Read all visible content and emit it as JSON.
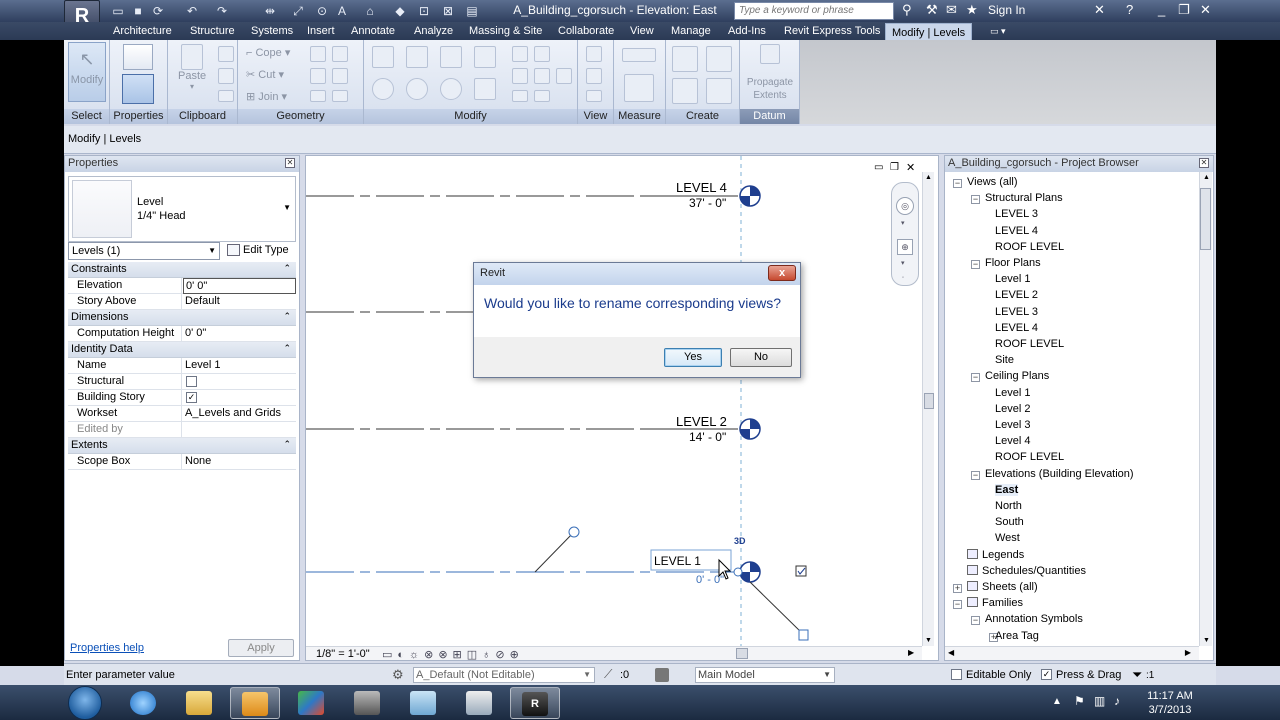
{
  "window": {
    "title": "A_Building_cgorsuch - Elevation: East",
    "search_placeholder": "Type a keyword or phrase",
    "signin": "Sign In"
  },
  "tabs": [
    "Architecture",
    "Structure",
    "Systems",
    "Insert",
    "Annotate",
    "Analyze",
    "Massing & Site",
    "Collaborate",
    "View",
    "Manage",
    "Add-Ins",
    "Revit Express Tools",
    "Modify | Levels"
  ],
  "active_tab": "Modify | Levels",
  "ribbon": {
    "modify_label": "Modify",
    "paste_label": "Paste",
    "copy_label": "Cope",
    "cut_label": "Cut",
    "join_label": "Join",
    "propagate_label": "Propagate Extents",
    "panels": {
      "select": "Select",
      "properties": "Properties",
      "clipboard": "Clipboard",
      "geometry": "Geometry",
      "modify": "Modify",
      "view": "View",
      "measure": "Measure",
      "create": "Create",
      "datum": "Datum"
    }
  },
  "options_bar": {
    "label": "Modify | Levels"
  },
  "properties": {
    "header": "Properties",
    "type_name": "Level",
    "type_sub": "1/4\" Head",
    "instance_selector": "Levels (1)",
    "edit_type": "Edit Type",
    "groups": {
      "constraints": "Constraints",
      "dimensions": "Dimensions",
      "identity": "Identity Data",
      "extents": "Extents"
    },
    "rows": {
      "elevation": {
        "k": "Elevation",
        "v": "0'  0\""
      },
      "story_above": {
        "k": "Story Above",
        "v": "Default"
      },
      "comp_height": {
        "k": "Computation Height",
        "v": "0'  0\""
      },
      "name": {
        "k": "Name",
        "v": "Level 1"
      },
      "structural": {
        "k": "Structural",
        "checked": false
      },
      "building_story": {
        "k": "Building Story",
        "checked": true
      },
      "workset": {
        "k": "Workset",
        "v": "A_Levels and Grids"
      },
      "edited_by": {
        "k": "Edited by",
        "v": ""
      },
      "scope_box": {
        "k": "Scope Box",
        "v": "None"
      }
    },
    "help_link": "Properties help",
    "apply": "Apply"
  },
  "drawing": {
    "levels": [
      {
        "name": "LEVEL 4",
        "elev": "37' - 0\""
      },
      {
        "name": "LEVEL 2",
        "elev": "14' - 0\""
      },
      {
        "name": "LEVEL 1",
        "elev": "0' - 0\""
      }
    ],
    "tag_3d": "3D",
    "scale": "1/8\" = 1'-0\""
  },
  "dialog": {
    "title": "Revit",
    "message": "Would you like to rename corresponding views?",
    "yes": "Yes",
    "no": "No",
    "close": "x"
  },
  "browser": {
    "header": "A_Building_cgorsuch - Project Browser",
    "items": [
      {
        "label": "Views (all)",
        "level": 0,
        "exp": "-"
      },
      {
        "label": "Structural Plans",
        "level": 1,
        "exp": "-"
      },
      {
        "label": "LEVEL 3",
        "level": 2
      },
      {
        "label": "LEVEL 4",
        "level": 2
      },
      {
        "label": "ROOF LEVEL",
        "level": 2
      },
      {
        "label": "Floor Plans",
        "level": 1,
        "exp": "-"
      },
      {
        "label": "Level 1",
        "level": 2
      },
      {
        "label": "LEVEL 2",
        "level": 2
      },
      {
        "label": "LEVEL 3",
        "level": 2
      },
      {
        "label": "LEVEL 4",
        "level": 2
      },
      {
        "label": "ROOF LEVEL",
        "level": 2
      },
      {
        "label": "Site",
        "level": 2
      },
      {
        "label": "Ceiling Plans",
        "level": 1,
        "exp": "-"
      },
      {
        "label": "Level 1",
        "level": 2
      },
      {
        "label": "Level 2",
        "level": 2
      },
      {
        "label": "Level 3",
        "level": 2
      },
      {
        "label": "Level 4",
        "level": 2
      },
      {
        "label": "ROOF LEVEL",
        "level": 2
      },
      {
        "label": "Elevations (Building Elevation)",
        "level": 1,
        "exp": "-"
      },
      {
        "label": "East",
        "level": 2,
        "bold": true
      },
      {
        "label": "North",
        "level": 2
      },
      {
        "label": "South",
        "level": 2
      },
      {
        "label": "West",
        "level": 2
      },
      {
        "label": "Legends",
        "level": 0,
        "icon": true
      },
      {
        "label": "Schedules/Quantities",
        "level": 0,
        "icon": true
      },
      {
        "label": "Sheets (all)",
        "level": 0,
        "exp": "+",
        "icon": true
      },
      {
        "label": "Families",
        "level": 0,
        "exp": "-",
        "icon": true
      },
      {
        "label": "Annotation Symbols",
        "level": 1,
        "exp": "-"
      },
      {
        "label": "Area Tag",
        "level": 2,
        "exp": "+"
      }
    ]
  },
  "status": {
    "text": "Enter parameter value",
    "workset": "A_Default (Not Editable)",
    "count": ":0",
    "model": "Main Model",
    "editable_only": "Editable Only",
    "press_drag": "Press & Drag",
    "filter_count": ":1"
  },
  "clock": {
    "time": "11:17 AM",
    "date": "3/7/2013"
  }
}
